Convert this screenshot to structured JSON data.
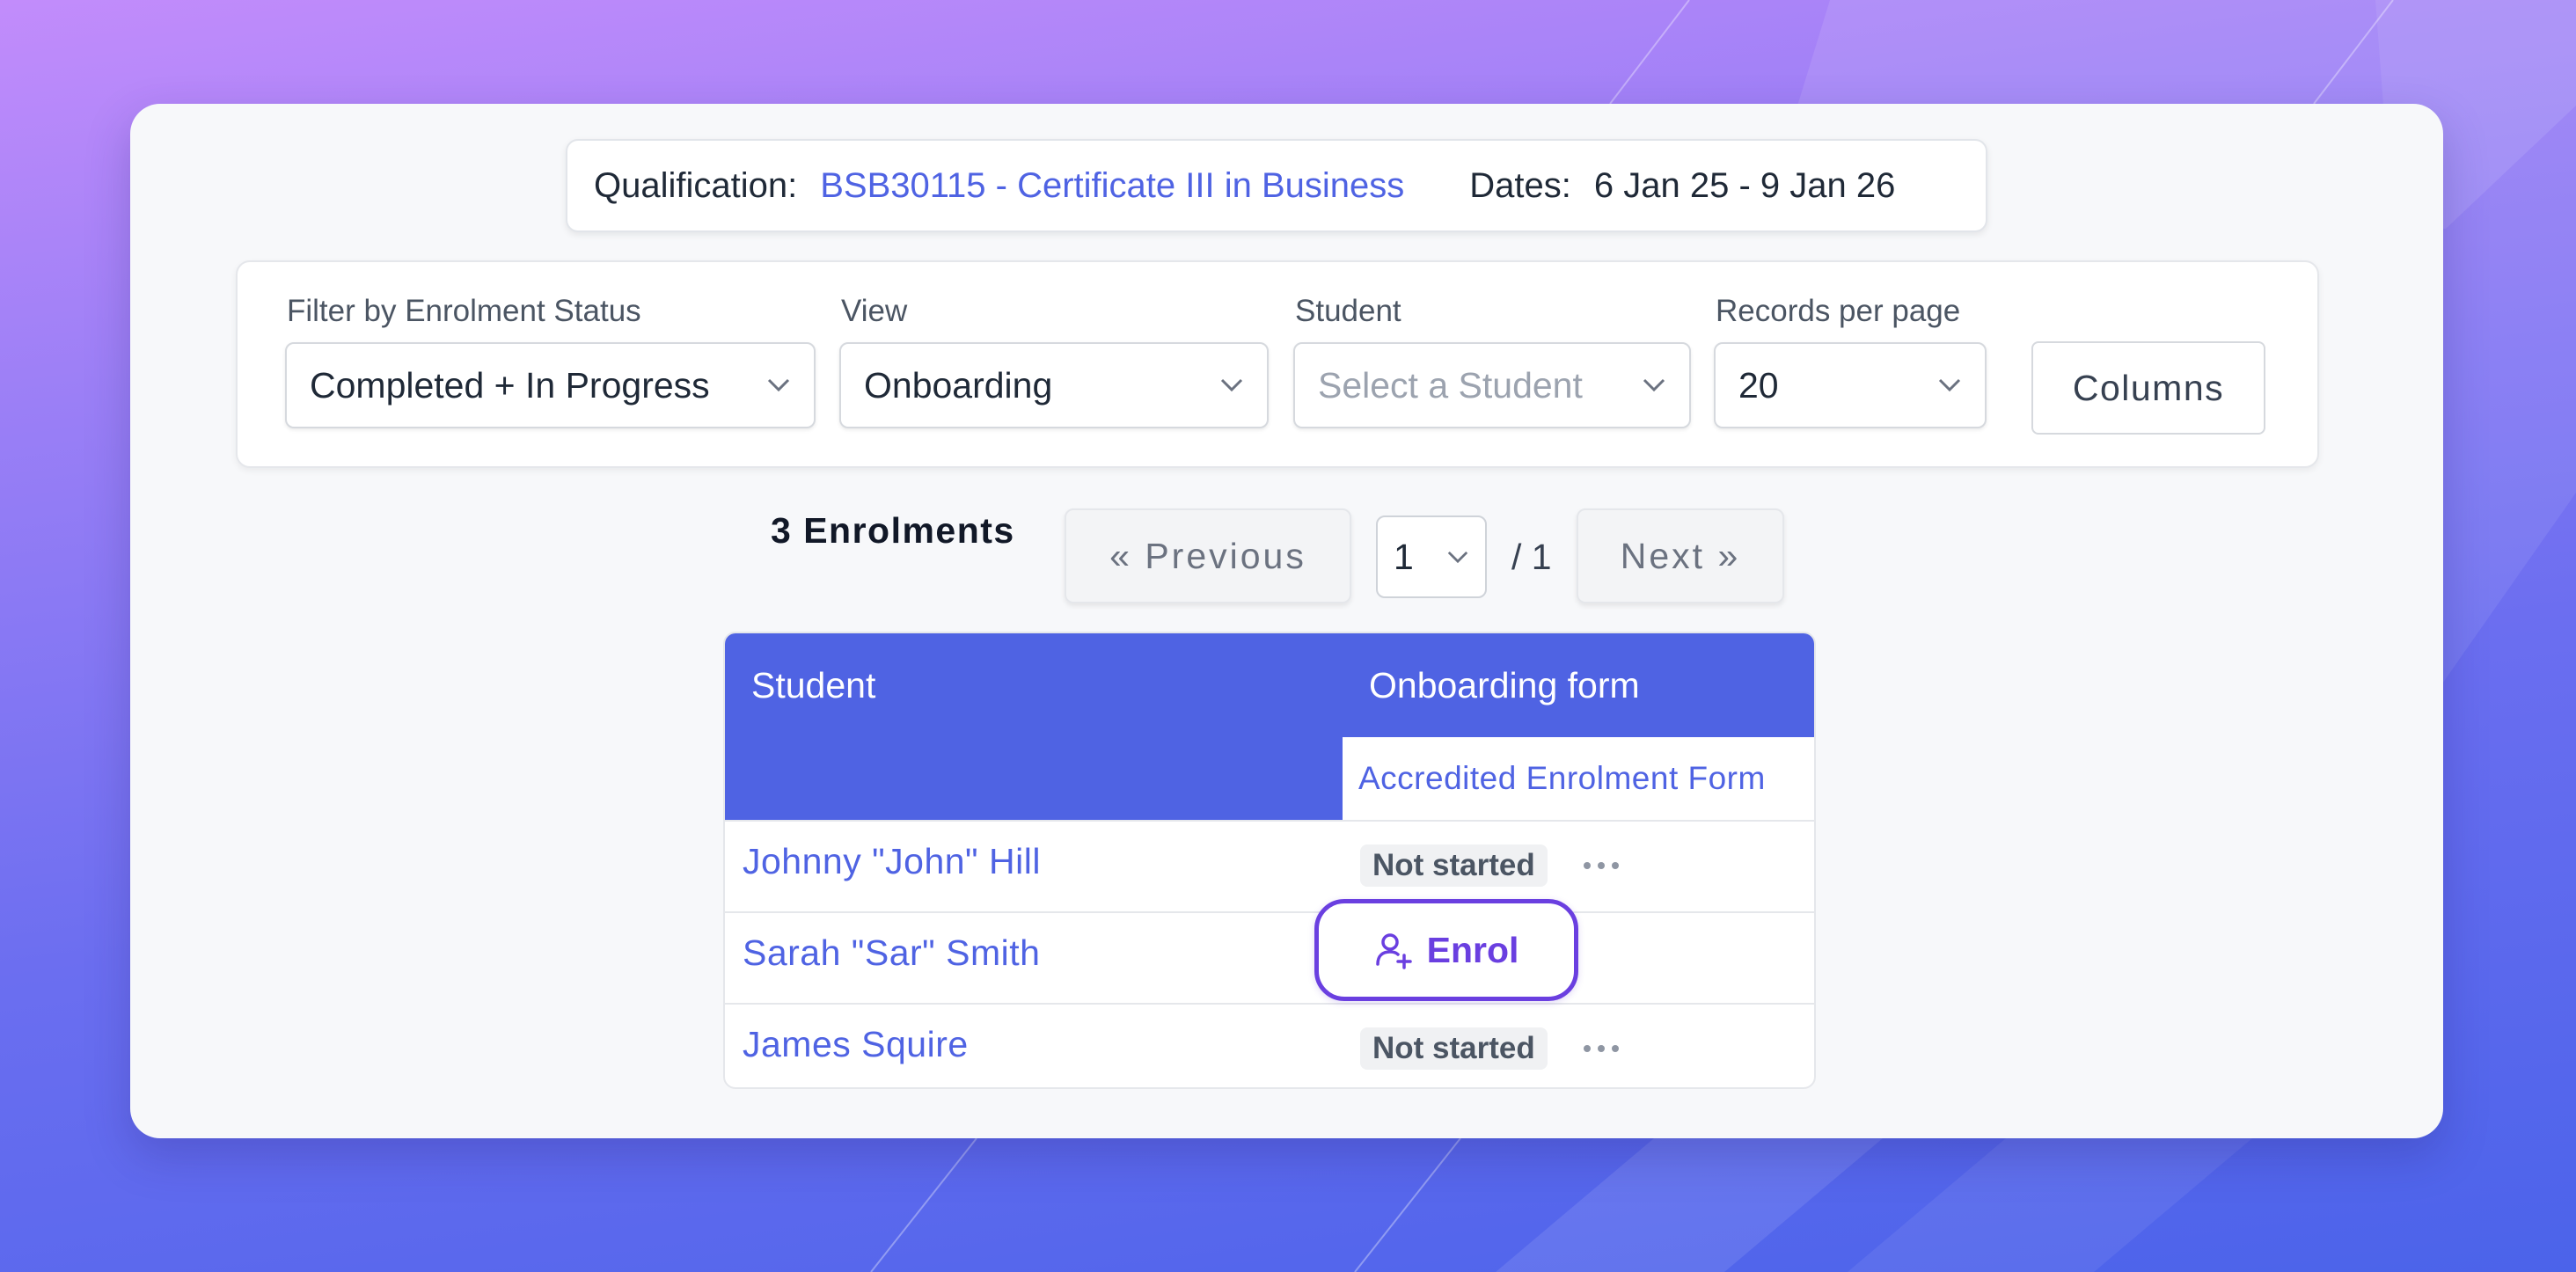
{
  "qualification": {
    "label": "Qualification:",
    "value": "BSB30115 - Certificate III in Business",
    "dates_label": "Dates:",
    "dates_value": "6 Jan 25 - 9 Jan 26"
  },
  "filters": {
    "status": {
      "label": "Filter by Enrolment Status",
      "value": "Completed + In Progress"
    },
    "view": {
      "label": "View",
      "value": "Onboarding"
    },
    "student": {
      "label": "Student",
      "placeholder": "Select a Student"
    },
    "records": {
      "label": "Records per page",
      "value": "20"
    },
    "columns_label": "Columns"
  },
  "pagination": {
    "count_label": "3 Enrolments",
    "previous_label": "« Previous",
    "page_value": "1",
    "total_label": "/ 1",
    "next_label": "Next »"
  },
  "table": {
    "col_student": "Student",
    "col_onboarding": "Onboarding form",
    "sub_header": "Accredited Enrolment Form",
    "rows": [
      {
        "name": "Johnny \"John\" Hill",
        "status": "Not started"
      },
      {
        "name": "Sarah \"Sar\" Smith",
        "action": "Enrol"
      },
      {
        "name": "James Squire",
        "status": "Not started"
      }
    ]
  },
  "colors": {
    "accent": "#4f63e3",
    "enrol": "#6a3fe0"
  }
}
